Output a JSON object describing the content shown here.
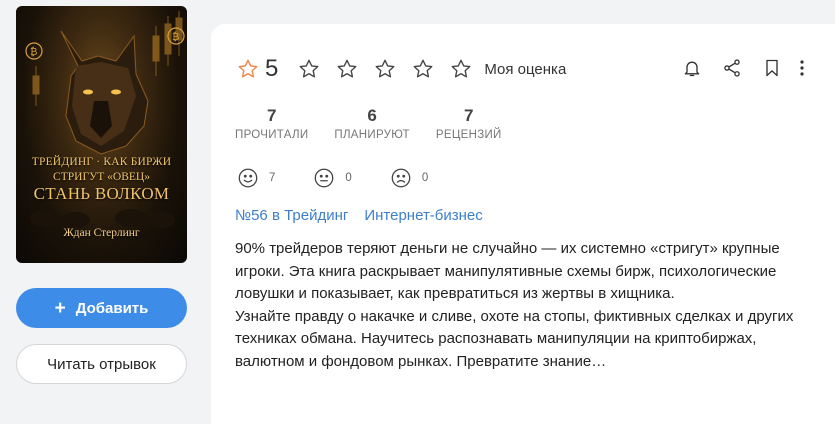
{
  "book": {
    "cover": {
      "title_line1": "ТРЕЙДИНГ · КАК БИРЖИ",
      "title_line2": "СТРИГУТ «ОВЕЦ»",
      "title_line3": "СТАНЬ ВОЛКОМ",
      "author": "Ждан Стерлинг"
    }
  },
  "buttons": {
    "add_icon": "+",
    "add_label": "Добавить",
    "read_label": "Читать отрывок"
  },
  "rating": {
    "value": "5",
    "my_rating_label": "Моя оценка",
    "empty_stars_count": 5
  },
  "actions": [
    "bell-icon",
    "share-icon",
    "bookmark-icon",
    "more-vertical-icon"
  ],
  "stats": [
    {
      "num": "7",
      "label": "ПРОЧИТАЛИ"
    },
    {
      "num": "6",
      "label": "ПЛАНИРУЮТ"
    },
    {
      "num": "7",
      "label": "РЕЦЕНЗИЙ"
    }
  ],
  "reactions": [
    {
      "icon": "smile-icon",
      "count": "7"
    },
    {
      "icon": "neutral-face-icon",
      "count": "0"
    },
    {
      "icon": "sad-face-icon",
      "count": "0"
    }
  ],
  "tags": [
    "№56 в Трейдинг",
    "Интернет-бизнес"
  ],
  "description": {
    "p1": "90% трейдеров теряют деньги не случайно — их системно «стригут» крупные игроки. Эта книга раскрывает манипулятивные схемы бирж, психологические ловушки и показывает, как превратиться из жертвы в хищника.",
    "p2": "Узнайте правду о накачке и сливе, охоте на стопы, фиктивных сделках и других техниках обмана. Научитесь распознавать манипуляции на криптобиржах, валютном и фондовом рынках. Превратите знание…"
  },
  "colors": {
    "accent": "#3d8ce8",
    "link": "#3d7fc8",
    "star_main": "#f08a4b",
    "background": "#f2f3f5",
    "cover_gold": "#f0c36a"
  }
}
